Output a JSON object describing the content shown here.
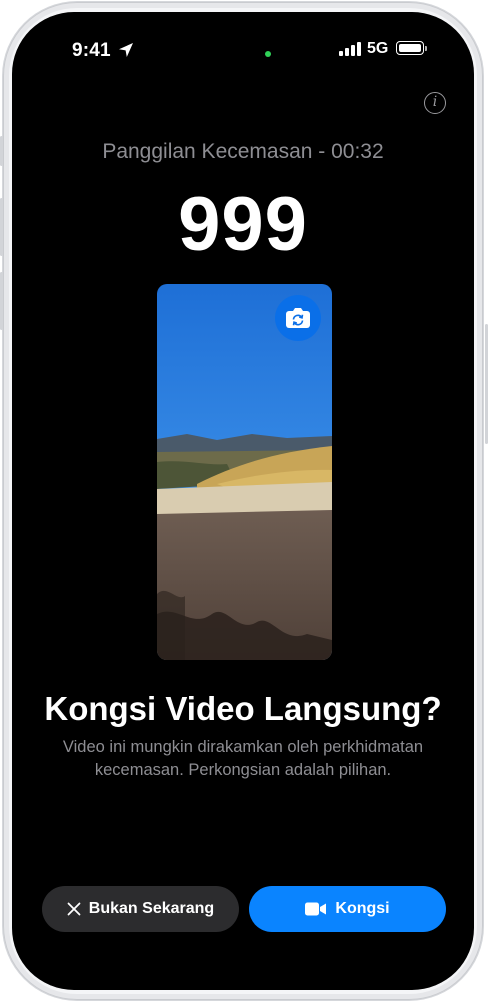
{
  "status_bar": {
    "time": "9:41",
    "network": "5G",
    "location_icon": "location-arrow-icon",
    "signal_icon": "cellular-signal-icon",
    "battery_icon": "battery-full-icon",
    "camera_indicator_color": "#30d158"
  },
  "call": {
    "status": "Panggilan Kecemasan - 00:32",
    "number": "999"
  },
  "preview": {
    "flip_camera_icon": "camera-flip-icon",
    "flip_button_color": "#0a6fe8"
  },
  "prompt": {
    "title": "Kongsi Video Langsung?",
    "description": "Video ini mungkin dirakamkan oleh perkhidmatan kecemasan. Perkongsian adalah pilihan."
  },
  "actions": {
    "decline_label": "Bukan Sekarang",
    "decline_icon": "close-icon",
    "share_label": "Kongsi",
    "share_icon": "video-camera-icon",
    "share_color": "#0a84ff"
  },
  "info_icon": "info-icon"
}
